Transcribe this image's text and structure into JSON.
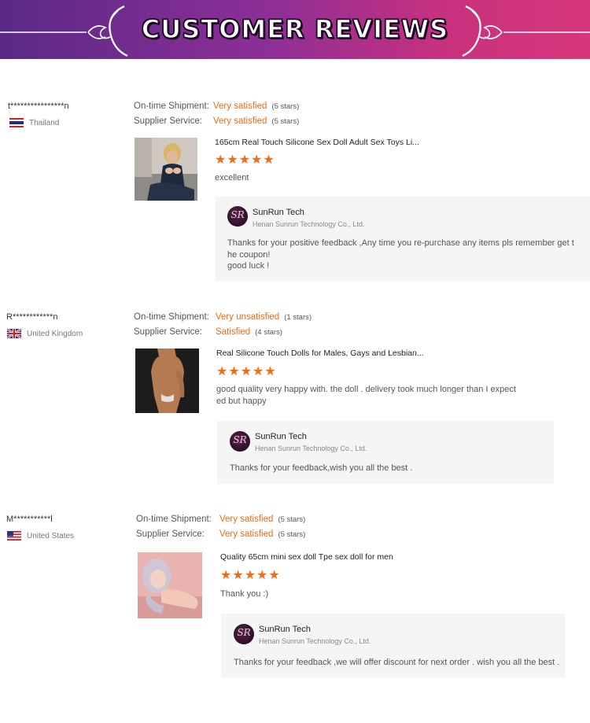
{
  "header": {
    "title": "CUSTOMER REVIEWS"
  },
  "labels": {
    "shipment": "On-time Shipment:",
    "service": "Supplier Service:"
  },
  "colors": {
    "accent": "#f06a13",
    "banner_start": "#5a2a86",
    "banner_end": "#d7377a"
  },
  "reviews": [
    {
      "buyer": "t****************n",
      "country": "Thailand",
      "flag": "thailand-flag",
      "shipment_value": "Very satisfied",
      "shipment_stars": "(5 stars)",
      "service_value": "Very satisfied",
      "service_stars": "(5 stars)",
      "product_title": "165cm Real Touch Silicone Sex Doll Adult Sex Toys Li...",
      "stars": "★★★★★",
      "comment": "excellent",
      "reply": {
        "shop": "SunRun Tech",
        "company": "Henan Sunrun Technology Co., Ltd.",
        "text": "Thanks for your positive feedback ,Any time you re-purchase any items pls remember  get t\nhe coupon!\ngood luck !"
      }
    },
    {
      "buyer": "R************n",
      "country": "United Kingdom",
      "flag": "uk-flag",
      "shipment_value": "Very unsatisfied",
      "shipment_stars": "(1 stars)",
      "service_value": "Satisfied",
      "service_stars": "(4 stars)",
      "product_title": "Real Silicone Touch Dolls for Males, Gays and Lesbian...",
      "stars": "★★★★★",
      "comment": "good quality very happy with. the doll . delivery took much longer than I expect\ned but happy",
      "reply": {
        "shop": "SunRun Tech",
        "company": "Henan Sunrun Technology Co., Ltd.",
        "text": "Thanks for your feedback,wish you all the best ."
      }
    },
    {
      "buyer": "M***********l",
      "country": "United States",
      "flag": "us-flag",
      "shipment_value": "Very satisfied",
      "shipment_stars": "(5 stars)",
      "service_value": "Very satisfied",
      "service_stars": "(5 stars)",
      "product_title": "Quality 65cm mini sex doll Tpe sex doll for men",
      "stars": "★★★★★",
      "comment": "Thank you :)",
      "reply": {
        "shop": "SunRun Tech",
        "company": "Henan Sunrun Technology Co., Ltd.",
        "text": "Thanks for your feedback ,we will offer discount  for next order . wish you all the best ."
      }
    }
  ]
}
